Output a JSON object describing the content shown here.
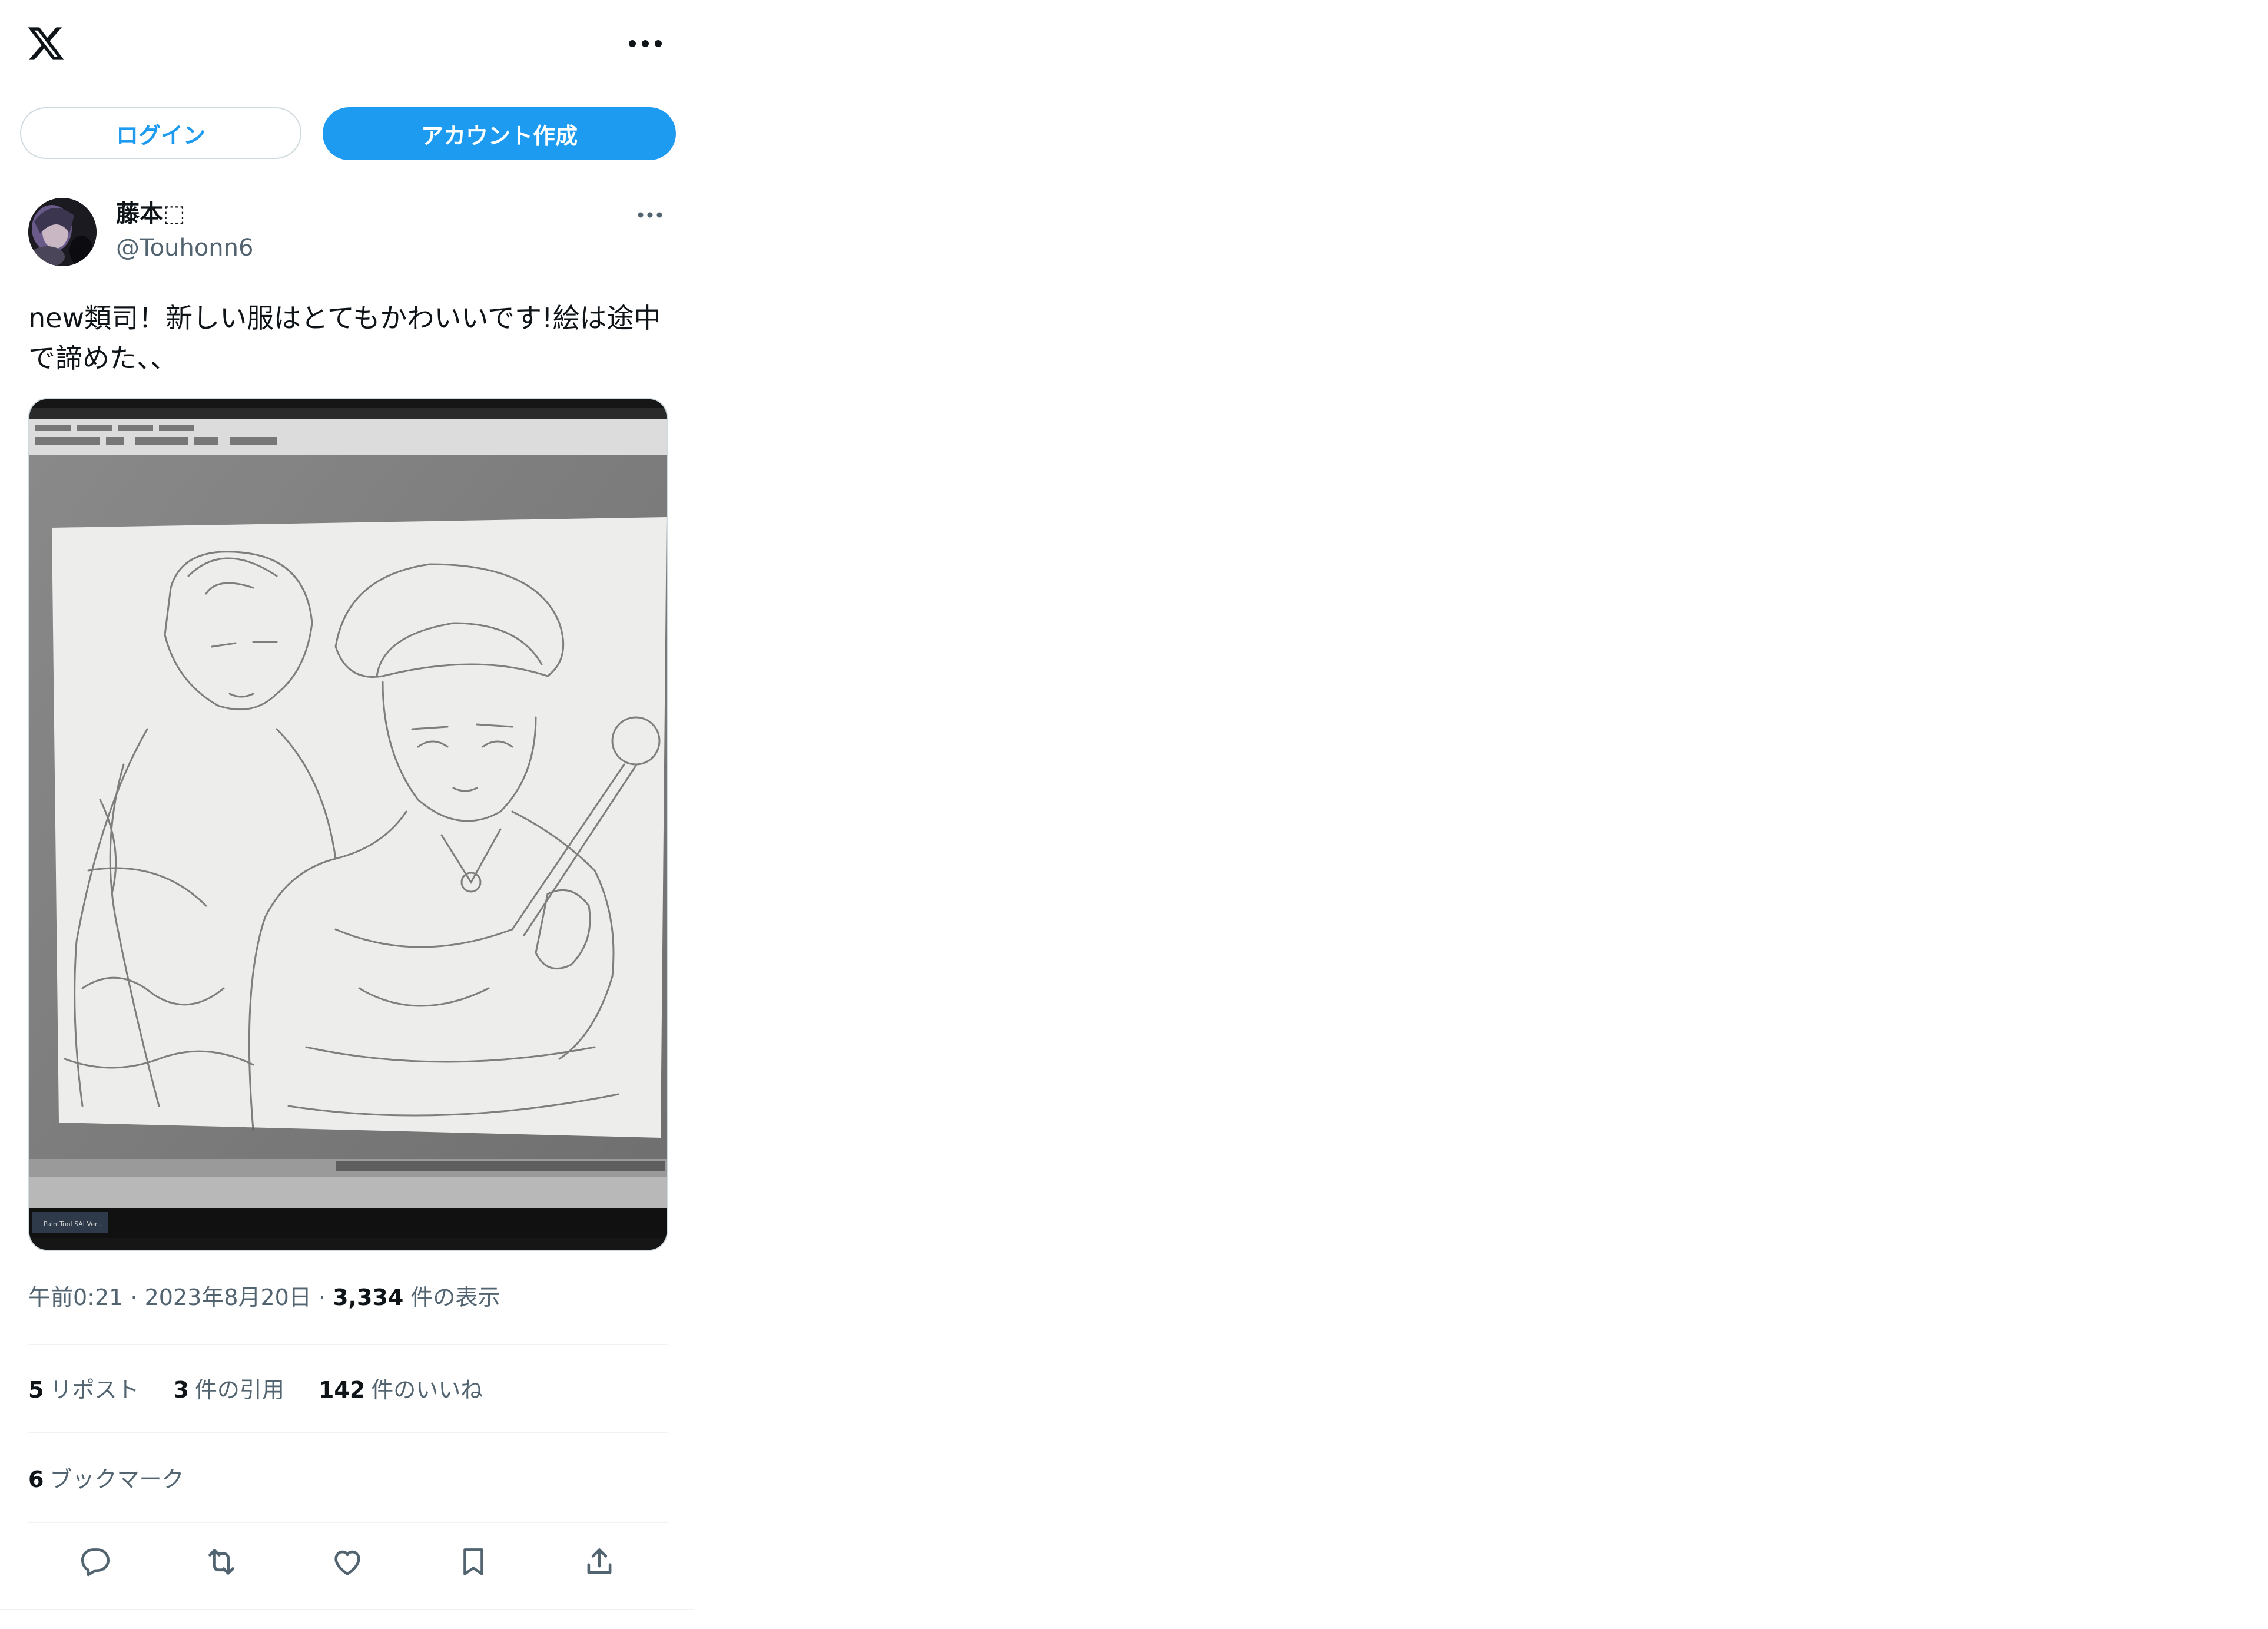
{
  "topbar": {
    "logo_icon": "x-logo-icon",
    "more_icon": "more-horizontal-icon"
  },
  "auth": {
    "login_label": "ログイン",
    "signup_label": "アカウント作成"
  },
  "tweet": {
    "author": {
      "name": "藤本⬚",
      "handle": "@Touhonn6"
    },
    "text": "new類司！新しい服はとてもかわいいです!絵は途中で諦めた、、",
    "media": {
      "app_title": "PaintTool SAI Ver..."
    },
    "meta": {
      "time": "午前0:21",
      "sep1": " · ",
      "date": "2023年8月20日",
      "sep2": " · ",
      "views_count": "3,334",
      "views_label": " 件の表示"
    },
    "stats": {
      "reposts_count": "5",
      "reposts_label": "リポスト",
      "quotes_count": "3",
      "quotes_label": "件の引用",
      "likes_count": "142",
      "likes_label": "件のいいね",
      "bookmarks_count": "6",
      "bookmarks_label": "ブックマーク"
    },
    "actions": [
      "reply-icon",
      "repost-icon",
      "like-icon",
      "bookmark-icon",
      "share-icon"
    ]
  },
  "colors": {
    "accent": "#1d9bf0",
    "text_primary": "#0f1419",
    "text_secondary": "#536471",
    "border": "#cfd9de"
  }
}
